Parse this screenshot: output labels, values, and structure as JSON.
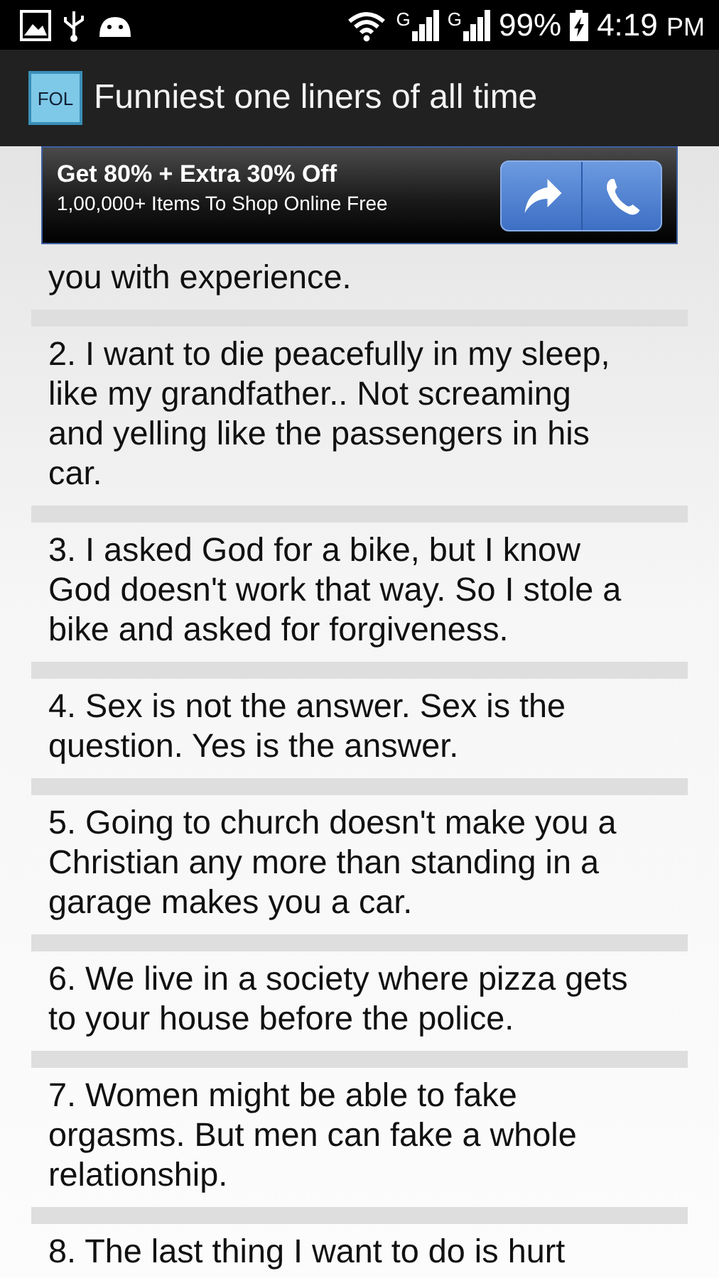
{
  "status_bar": {
    "battery": "99%",
    "time": "4:19",
    "meridiem": "PM",
    "signal_labels": [
      "G",
      "G"
    ]
  },
  "app_bar": {
    "icon_label": "FOL",
    "title": "Funniest one liners of all time"
  },
  "ad": {
    "headline": "Get 80% + Extra 30% Off",
    "subline": "1,00,000+ Items To Shop Online Free"
  },
  "items": [
    {
      "lines": [
        "you with experience."
      ]
    },
    {
      "lines": [
        "2. I want to die peacefully in my sleep,",
        "like my grandfather.. Not screaming",
        "and yelling like the passengers in his",
        "car."
      ]
    },
    {
      "lines": [
        "3. I asked God for a bike, but I know",
        "God doesn't work that way. So I stole a",
        "bike and asked for forgiveness."
      ]
    },
    {
      "lines": [
        "4. Sex is not the answer. Sex is the",
        "question. Yes is the answer."
      ]
    },
    {
      "lines": [
        "5. Going to church doesn't make you a",
        "Christian any more than standing in a",
        "garage makes you a car."
      ]
    },
    {
      "lines": [
        "6. We live in a society where pizza gets",
        "to your house before the police."
      ]
    },
    {
      "lines": [
        "7. Women might be able to fake",
        "orgasms. But men can fake a whole",
        "relationship."
      ]
    },
    {
      "lines": [
        "8. The last thing I want to do is hurt"
      ]
    }
  ]
}
